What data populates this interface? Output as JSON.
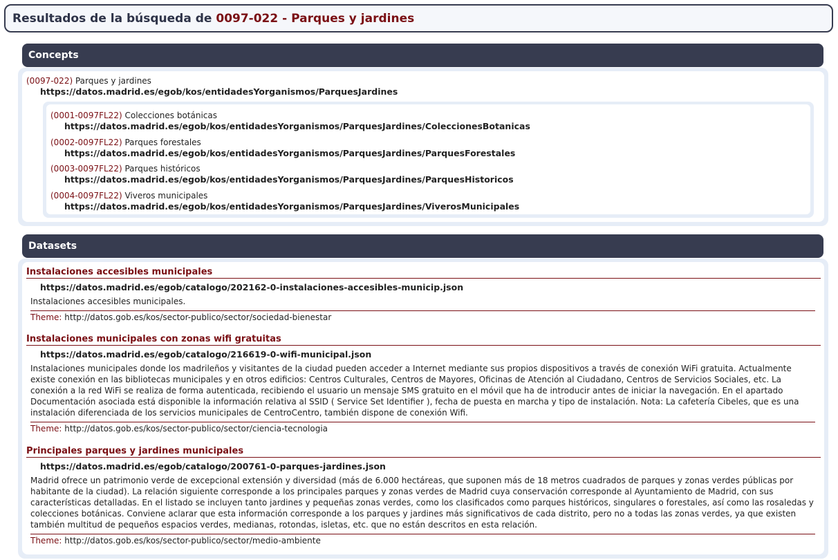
{
  "header": {
    "prefix": "Resultados de la búsqueda de",
    "highlight": "0097-022 - Parques y jardines"
  },
  "concepts": {
    "title": "Concepts",
    "root": {
      "code": "(0097-022)",
      "label": "Parques y jardines",
      "uri": "https://datos.madrid.es/egob/kos/entidadesYorganismos/ParquesJardines"
    },
    "children": [
      {
        "code": "(0001-0097FL22)",
        "label": "Colecciones botánicas",
        "uri": "https://datos.madrid.es/egob/kos/entidadesYorganismos/ParquesJardines/ColeccionesBotanicas"
      },
      {
        "code": "(0002-0097FL22)",
        "label": "Parques forestales",
        "uri": "https://datos.madrid.es/egob/kos/entidadesYorganismos/ParquesJardines/ParquesForestales"
      },
      {
        "code": "(0003-0097FL22)",
        "label": "Parques históricos",
        "uri": "https://datos.madrid.es/egob/kos/entidadesYorganismos/ParquesJardines/ParquesHistoricos"
      },
      {
        "code": "(0004-0097FL22)",
        "label": "Viveros municipales",
        "uri": "https://datos.madrid.es/egob/kos/entidadesYorganismos/ParquesJardines/ViverosMunicipales"
      }
    ]
  },
  "datasets": {
    "title": "Datasets",
    "theme_label": "Theme:",
    "items": [
      {
        "title": "Instalaciones accesibles municipales",
        "uri": "https://datos.madrid.es/egob/catalogo/202162-0-instalaciones-accesibles-municip.json",
        "description": "Instalaciones accesibles municipales.",
        "theme": "http://datos.gob.es/kos/sector-publico/sector/sociedad-bienestar"
      },
      {
        "title": "Instalaciones municipales con zonas wifi gratuitas",
        "uri": "https://datos.madrid.es/egob/catalogo/216619-0-wifi-municipal.json",
        "description": "Instalaciones municipales donde los madrileños y visitantes de la ciudad pueden acceder a Internet mediante sus propios dispositivos a través de conexión WiFi gratuita. Actualmente existe conexión en las bibliotecas municipales y en otros edificios: Centros Culturales, Centros de Mayores, Oficinas de Atención al Ciudadano, Centros de Servicios Sociales, etc. La conexión a la red WiFi se realiza de forma autenticada, recibiendo el usuario un mensaje SMS gratuito en el móvil que ha de introducir antes de iniciar la navegación. En el apartado Documentación asociada está disponible la información relativa al SSID ( Service Set Identifier ), fecha de puesta en marcha y tipo de instalación. Nota: La cafetería Cibeles, que es una instalación diferenciada de los servicios municipales de CentroCentro, también dispone de conexión Wifi.",
        "theme": "http://datos.gob.es/kos/sector-publico/sector/ciencia-tecnologia"
      },
      {
        "title": "Principales parques y jardines municipales",
        "uri": "https://datos.madrid.es/egob/catalogo/200761-0-parques-jardines.json",
        "description": "Madrid ofrece un patrimonio verde de excepcional extensión y diversidad (más de 6.000 hectáreas, que suponen más de 18 metros cuadrados de parques y zonas verdes públicas por habitante de la ciudad). La relación siguiente corresponde a los principales parques y zonas verdes de Madrid cuya conservación corresponde al Ayuntamiento de Madrid, con sus características detalladas. En el listado se incluyen tanto jardines y pequeñas zonas verdes, como los clasificados como parques históricos, singulares o forestales, así como las rosaledas y colecciones botánicas. Conviene aclarar que esta información corresponde a los parques y jardines más significativos de cada distrito, pero no a todas las zonas verdes, ya que existen también multitud de pequeños espacios verdes, medianas, rotondas, isletas, etc. que no están descritos en esta relación.",
        "theme": "http://datos.gob.es/kos/sector-publico/sector/medio-ambiente"
      }
    ]
  }
}
